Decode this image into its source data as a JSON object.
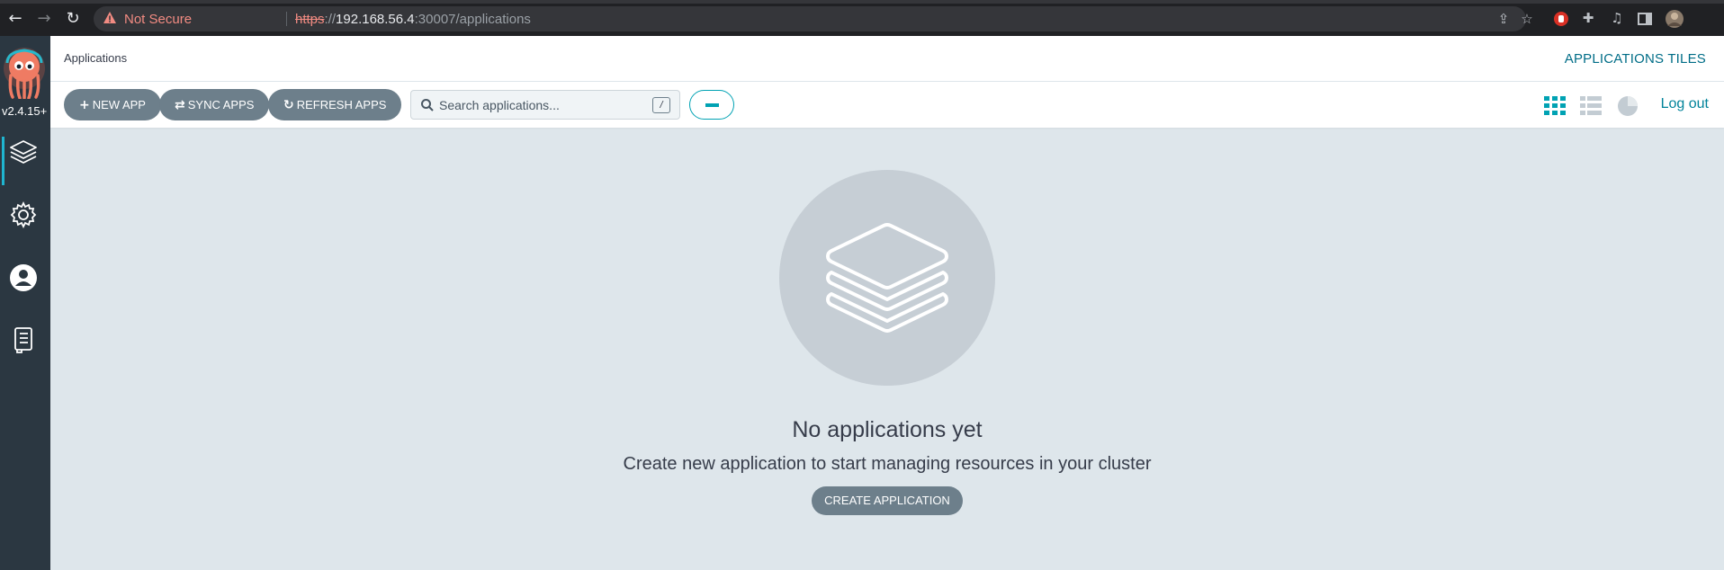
{
  "browser": {
    "security_label": "Not Secure",
    "url_scheme": "https",
    "url_sep": "://",
    "url_host": "192.168.56.4",
    "url_path": ":30007/applications"
  },
  "sidebar": {
    "version": "v2.4.15+",
    "items": [
      {
        "icon": "layers-icon",
        "active": true
      },
      {
        "icon": "gear-icon",
        "active": false
      },
      {
        "icon": "user-icon",
        "active": false
      },
      {
        "icon": "docs-icon",
        "active": false
      }
    ]
  },
  "header": {
    "title": "Applications",
    "view_mode": "APPLICATIONS TILES"
  },
  "toolbar": {
    "new_app": "NEW APP",
    "sync_apps": "SYNC APPS",
    "refresh_apps": "REFRESH APPS",
    "search_placeholder": "Search applications...",
    "search_shortcut": "/",
    "logout": "Log out"
  },
  "empty_state": {
    "title": "No applications yet",
    "subtitle": "Create new application to start managing resources in your cluster",
    "button": "CREATE APPLICATION"
  },
  "colors": {
    "accent": "#00a2b3",
    "button_bg": "#6d7f8b",
    "page_bg": "#dee6eb",
    "sidebar_bg": "#2b3741"
  }
}
